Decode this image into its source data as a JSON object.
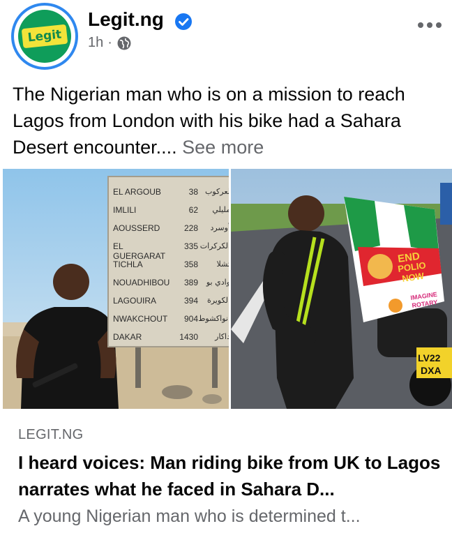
{
  "post": {
    "page_name": "Legit.ng",
    "avatar_text": "Legit",
    "time": "1h",
    "separator": "·",
    "text": "The Nigerian man who is on a mission to reach Lagos from London with his bike had a Sahara Desert encounter....",
    "see_more": "See more"
  },
  "photos": {
    "sign": {
      "rows": [
        {
          "town": "EL ARGOUB",
          "dist": "38",
          "arabic": "لعركوب"
        },
        {
          "town": "IMLILI",
          "dist": "62",
          "arabic": "مليلي"
        },
        {
          "town": "AOUSSERD",
          "dist": "228",
          "arabic": "أوسرد"
        },
        {
          "town": "EL GUERGARAT",
          "dist": "335",
          "arabic": "الكركرات"
        },
        {
          "town": "TICHLA",
          "dist": "358",
          "arabic": "تشلا"
        },
        {
          "town": "NOUADHIBOU",
          "dist": "389",
          "arabic": "وادي بو"
        },
        {
          "town": "LAGOUIRA",
          "dist": "394",
          "arabic": "الكويرة"
        },
        {
          "town": "NWAKCHOUT",
          "dist": "904",
          "arabic": "انواكشوط"
        },
        {
          "town": "DAKAR",
          "dist": "1430",
          "arabic": "داكار"
        }
      ]
    },
    "flag": {
      "line1": "END",
      "line2": "POLIO",
      "line3": "NOW",
      "imagine": "IMAGINE",
      "rotary": "ROTARY"
    },
    "plate": {
      "line1": "LV22",
      "line2": "DXA"
    }
  },
  "link": {
    "source": "LEGIT.NG",
    "title": "I heard voices: Man riding bike from UK to Lagos narrates what he faced in Sahara D...",
    "description": "A young Nigerian man who is determined t..."
  },
  "colors": {
    "verified": "#1877f2",
    "avatar_ring": "#2f88ef",
    "avatar_bg": "#0f9d5a",
    "avatar_label": "#f3e33a",
    "secondary_text": "#65676b"
  }
}
